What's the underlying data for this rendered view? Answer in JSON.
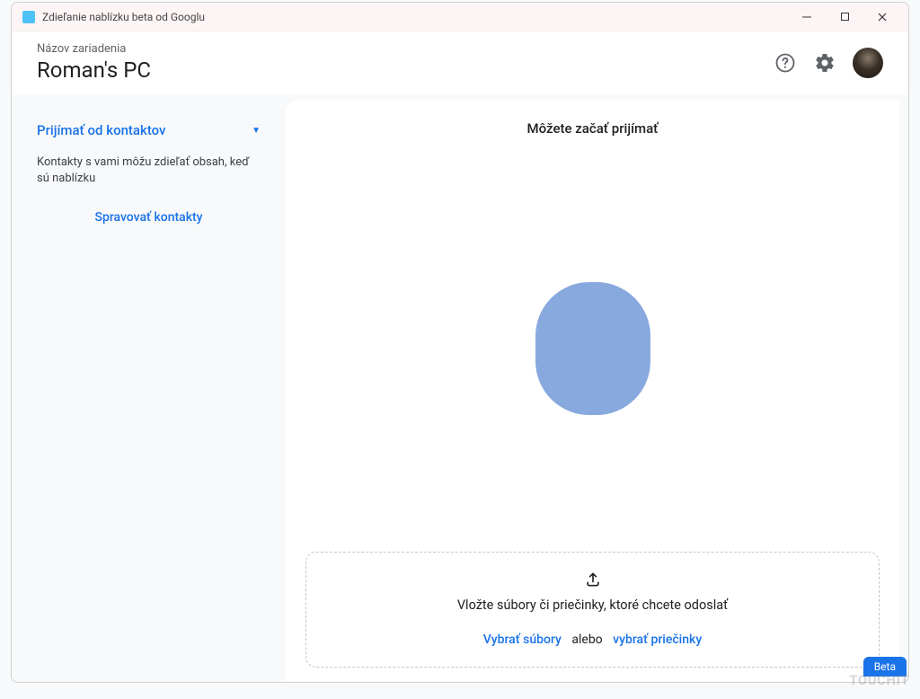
{
  "titlebar": {
    "title": "Zdieľanie nablízku beta od Googlu"
  },
  "header": {
    "device_label": "Názov zariadenia",
    "device_name": "Roman's PC"
  },
  "sidebar": {
    "dropdown_label": "Prijímať od kontaktov",
    "description": "Kontakty s vami môžu zdieľať obsah, keď sú nablízku",
    "manage_link": "Spravovať kontakty"
  },
  "main": {
    "title": "Môžete začať prijímať",
    "dropzone": {
      "text": "Vložte súbory či priečinky, ktoré chcete odoslať",
      "select_files": "Vybrať súbory",
      "or": "alebo",
      "select_folders": "vybrať priečinky"
    }
  },
  "footer": {
    "beta": "Beta"
  },
  "icons": {
    "help": "help-icon",
    "settings": "gear-icon",
    "minimize": "minimize-icon",
    "maximize": "maximize-icon",
    "close": "close-icon",
    "upload": "upload-icon"
  },
  "watermark": "TOUCHIT"
}
